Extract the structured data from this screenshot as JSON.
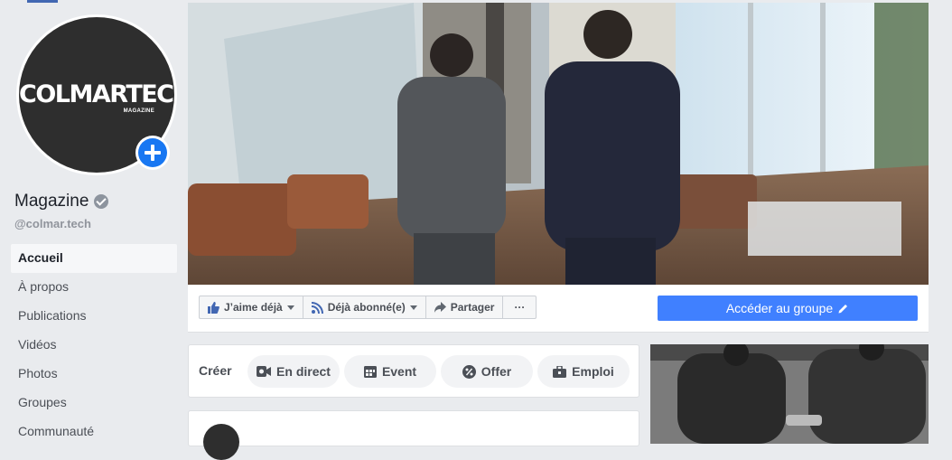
{
  "profile": {
    "logo_text": "COLMARTECH",
    "logo_subtext": "MAGAZINE",
    "name": "Magazine",
    "handle": "@colmar.tech",
    "icons": {
      "add": "plus-icon",
      "verified": "verified-check-icon"
    }
  },
  "nav": {
    "items": [
      {
        "label": "Accueil",
        "active": true
      },
      {
        "label": "À propos"
      },
      {
        "label": "Publications"
      },
      {
        "label": "Vidéos"
      },
      {
        "label": "Photos"
      },
      {
        "label": "Groupes"
      },
      {
        "label": "Communauté"
      }
    ]
  },
  "actions": {
    "like_label": "J’aime déjà",
    "follow_label": "Déjà abonné(e)",
    "share_label": "Partager",
    "more_label": "···",
    "group_label": "Accéder au groupe"
  },
  "create": {
    "label": "Créer",
    "items": [
      {
        "label": "En direct",
        "icon": "video-camera-icon"
      },
      {
        "label": "Event",
        "icon": "calendar-icon"
      },
      {
        "label": "Offer",
        "icon": "discount-icon"
      },
      {
        "label": "Emploi",
        "icon": "briefcase-icon"
      }
    ]
  },
  "colors": {
    "background": "#e9ebee",
    "accent_blue": "#4080ff",
    "add_button_blue": "#1877f2"
  }
}
